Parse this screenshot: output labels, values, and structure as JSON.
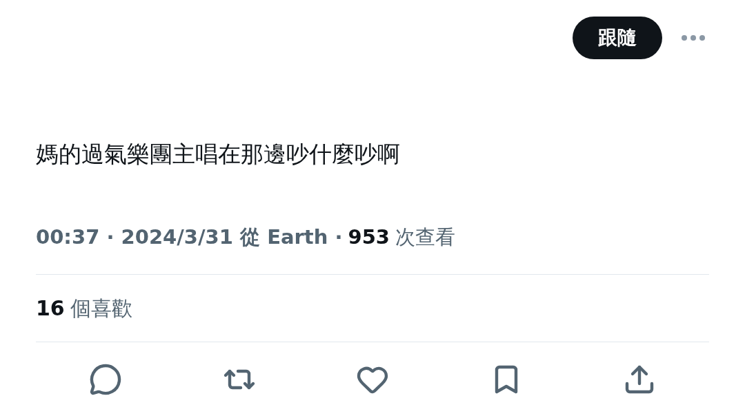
{
  "follow_button": {
    "label": "跟隨"
  },
  "tweet": {
    "text": "媽的過氣樂團主唱在那邊吵什麼吵啊"
  },
  "meta": {
    "timestamp": "00:37 · 2024/3/31 從 Earth ·",
    "views": {
      "count": "953",
      "label": "次查看"
    }
  },
  "likes": {
    "count": "16",
    "label": "個喜歡"
  },
  "actions": [
    {
      "kind": "reply"
    },
    {
      "kind": "repost"
    },
    {
      "kind": "like"
    },
    {
      "kind": "bookmark"
    },
    {
      "kind": "share"
    }
  ]
}
